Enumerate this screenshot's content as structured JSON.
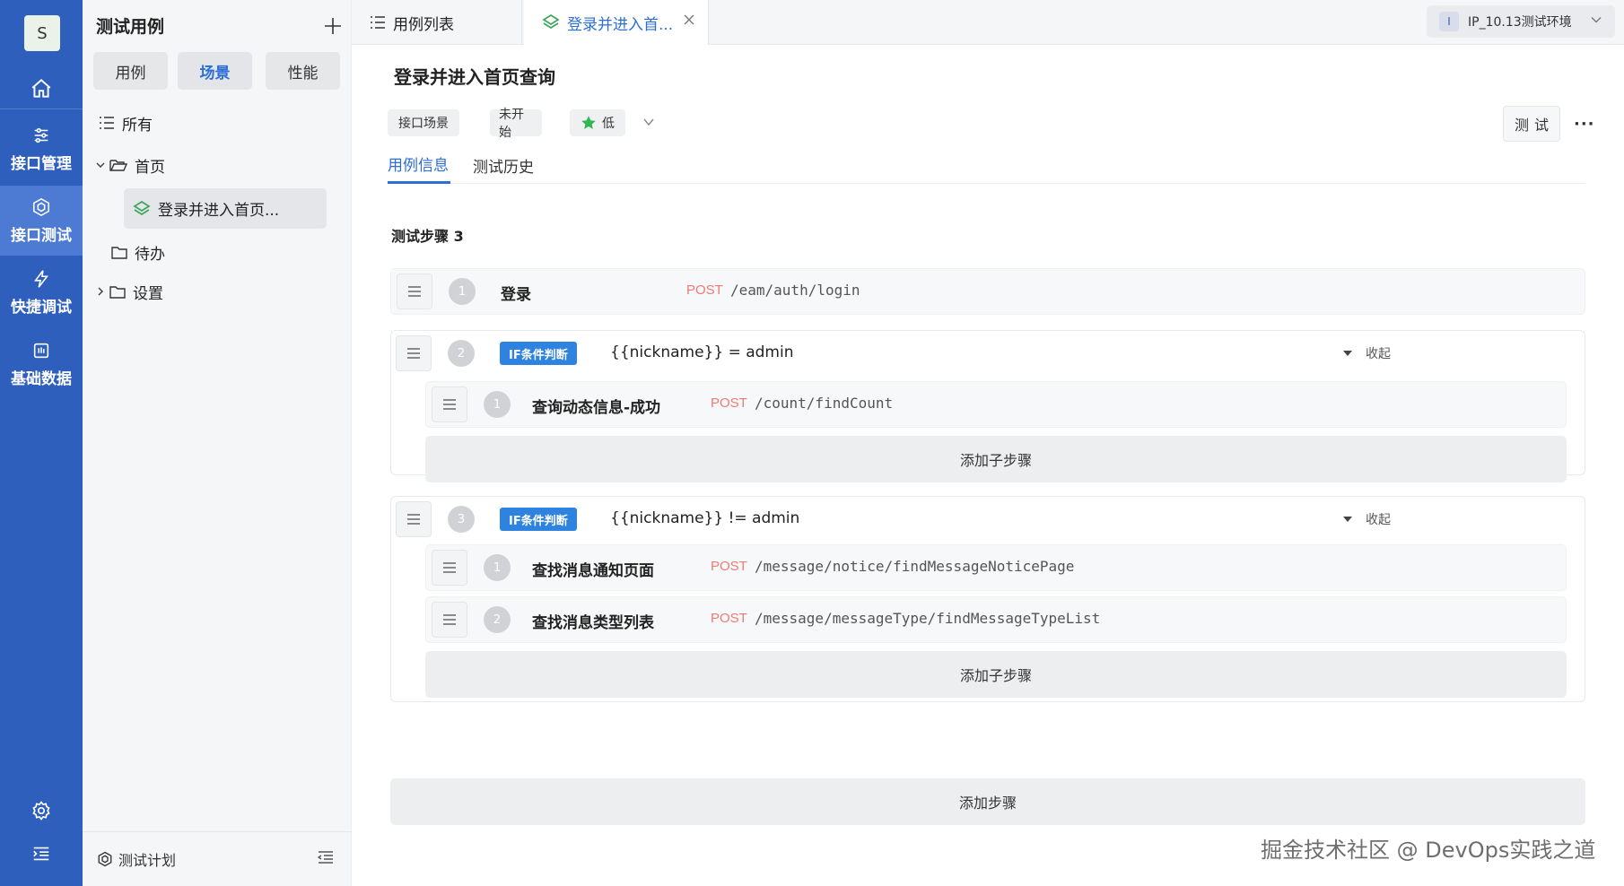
{
  "colors": {
    "nav_bg": "#2f5fbd",
    "nav_active": "#4d7bd3",
    "accent": "#2d6ed6",
    "method_post": "#f07a73",
    "if_tag": "#2f83e0"
  },
  "nav": {
    "avatar": "S",
    "items": [
      {
        "label": "接口管理",
        "icon": "sliders-icon"
      },
      {
        "label": "接口测试",
        "icon": "cube-icon",
        "active": true
      },
      {
        "label": "快捷调试",
        "icon": "lightning-icon"
      },
      {
        "label": "基础数据",
        "icon": "database-icon"
      }
    ]
  },
  "tree": {
    "title": "测试用例",
    "segments": [
      "用例",
      "场景",
      "性能"
    ],
    "active_segment": "场景",
    "all_label": "所有",
    "nodes": {
      "home": "首页",
      "selected_case": "登录并进入首页...",
      "todo": "待办",
      "settings": "设置"
    },
    "footer_label": "测试计划"
  },
  "tabs": [
    {
      "label": "用例列表"
    },
    {
      "label": "登录并进入首...",
      "active": true
    }
  ],
  "env": {
    "badge": "I",
    "label": "IP_10.13测试环境"
  },
  "main": {
    "title": "登录并进入首页查询",
    "tags": {
      "type": "接口场景",
      "status": "未开始",
      "priority": "低"
    },
    "test_button": "测试",
    "more": "···",
    "subtabs": [
      "用例信息",
      "测试历史"
    ],
    "steps_title": "测试步骤 3",
    "add_sub_label": "添加子步骤",
    "add_step_label": "添加步骤",
    "fold_label": "收起"
  },
  "steps": [
    {
      "no": "1",
      "name": "登录",
      "method": "POST",
      "path": "/eam/auth/login"
    },
    {
      "no": "2",
      "tag": "IF条件判断",
      "condition": "{{nickname}} = admin",
      "children": [
        {
          "no": "1",
          "name": "查询动态信息-成功",
          "method": "POST",
          "path": "/count/findCount"
        }
      ]
    },
    {
      "no": "3",
      "tag": "IF条件判断",
      "condition": "{{nickname}} != admin",
      "children": [
        {
          "no": "1",
          "name": "查找消息通知页面",
          "method": "POST",
          "path": "/message/notice/findMessageNoticePage"
        },
        {
          "no": "2",
          "name": "查找消息类型列表",
          "method": "POST",
          "path": "/message/messageType/findMessageTypeList"
        }
      ]
    }
  ],
  "watermark": "掘金技术社区 @ DevOps实践之道"
}
